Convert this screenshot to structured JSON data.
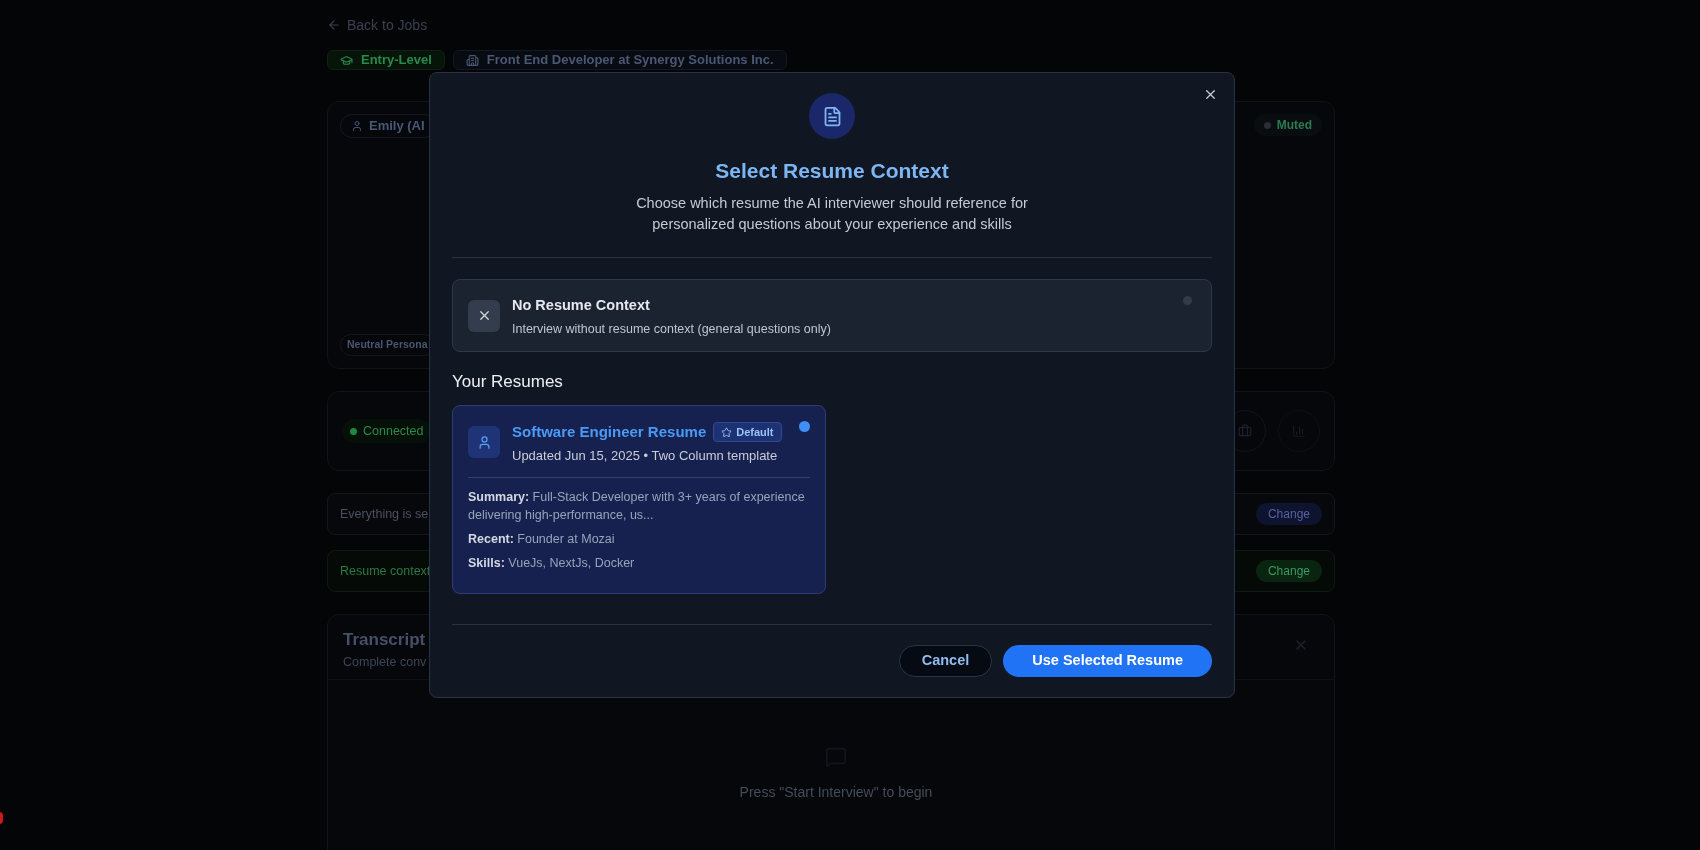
{
  "back_link": "Back to Jobs",
  "badges": [
    {
      "kind": "level",
      "label": "Entry-Level"
    },
    {
      "kind": "job",
      "label": "Front End Developer at Synergy Solutions Inc."
    }
  ],
  "interviewer_panel": {
    "name": "Emily (AI",
    "status": "Muted",
    "persona": "Neutral Persona"
  },
  "connection_panel": {
    "status": "Connected"
  },
  "notices": [
    {
      "kind": "info",
      "text": "Everything is se",
      "action": "Change"
    },
    {
      "kind": "success",
      "text": "Resume context",
      "action": "Change"
    }
  ],
  "transcript": {
    "title": "Transcript",
    "subtitle": "Complete conv",
    "empty_text": "Press \"Start Interview\" to begin"
  },
  "modal": {
    "title": "Select Resume Context",
    "description": "Choose which resume the AI interviewer should reference for personalized questions about your experience and skills",
    "options": [
      {
        "title": "No Resume Context",
        "description": "Interview without resume context (general questions only)",
        "selected": false
      }
    ],
    "section_title": "Your Resumes",
    "resumes": [
      {
        "title": "Software Engineer Resume",
        "badge": "Default",
        "meta": "Updated Jun 15, 2025 • Two Column template",
        "selected": true,
        "details": [
          "**Summary:** Full-Stack Developer with 3+ years of experience delivering high-performance, us...",
          "**Recent:** Founder at Mozai",
          "**Skills:** VueJs, NextJs, Docker"
        ]
      }
    ],
    "buttons": [
      {
        "kind": "secondary",
        "label": "Cancel"
      },
      {
        "kind": "primary",
        "label": "Use Selected Resume"
      }
    ]
  }
}
